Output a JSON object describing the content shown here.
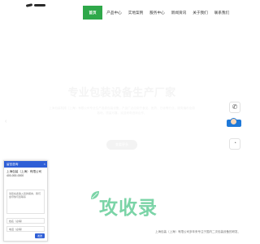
{
  "nav": {
    "items": [
      {
        "label": "首页",
        "active": true
      },
      {
        "label": "产品中心",
        "active": false
      },
      {
        "label": "实地案例",
        "active": false
      },
      {
        "label": "服务中心",
        "active": false
      },
      {
        "label": "新闻资讯",
        "active": false
      },
      {
        "label": "关于我们",
        "active": false
      },
      {
        "label": "联系我们",
        "active": false
      }
    ]
  },
  "hero": {
    "title": "专业包装设备生产厂家",
    "subtitle": "上海包装机械（上海）有限公司专业生产各类包装设备，产品广泛应用于食品、医药、日化等行业，服务遍布全国各地，质量可靠，欢迎来电咨询合作。",
    "button_label": "查看更多"
  },
  "chat": {
    "header_title": "留言咨询",
    "close_label": "×",
    "company": "上海包装（上海）有限公司",
    "phone": "400-000-0000",
    "message_placeholder": "请您在此输入您的留言，我们会尽快与您联系",
    "name_placeholder": "姓名（必填）",
    "tel_placeholder": "电话（必填）",
    "send_label": "发送"
  },
  "footer": {
    "text": "上海包装（上海）有限公司多年来专注于国内二次包装设备的研发、"
  },
  "watermark": "攻收录",
  "colors": {
    "nav_active": "#2fa84a",
    "chat_blue": "#2f5fd6",
    "watermark_green": "#4fc68a"
  }
}
